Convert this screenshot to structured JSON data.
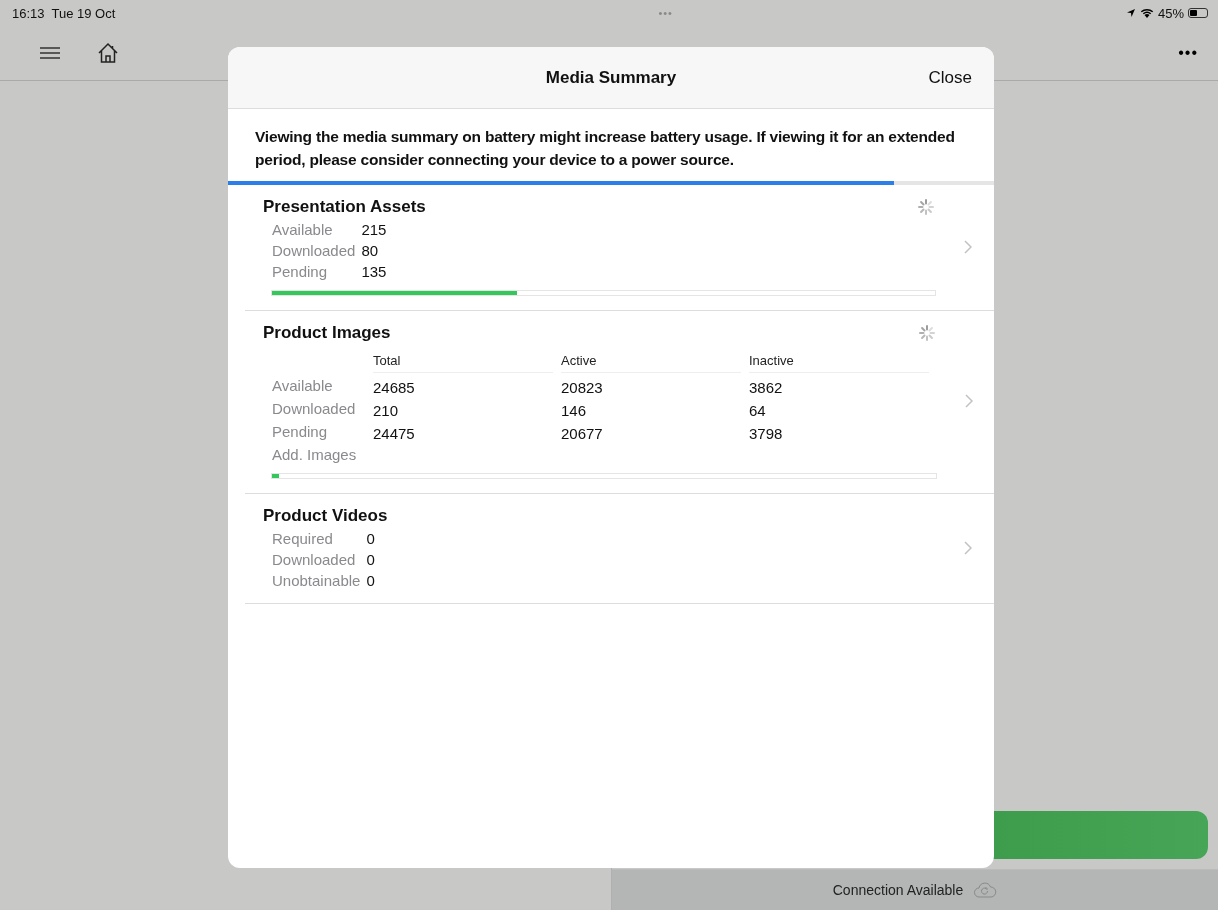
{
  "status_bar": {
    "time": "16:13",
    "date": "Tue 19 Oct",
    "battery": {
      "text": "45%",
      "level": 0.45
    }
  },
  "top_dots": "•••",
  "nav": {
    "more": "•••"
  },
  "background": {
    "connection": "Connection Available"
  },
  "modal": {
    "title": "Media Summary",
    "close": "Close",
    "warning": "Viewing the media summary on battery might increase battery usage. If viewing it for an extended period, please consider connecting your device to a power source.",
    "level": 0.87,
    "sections": [
      {
        "kind": "simple",
        "title": "Presentation Assets",
        "loading": true,
        "level": 0.37,
        "rows": [
          {
            "label": "Available",
            "value": "215"
          },
          {
            "label": "Downloaded",
            "value": "80"
          },
          {
            "label": "Pending",
            "value": "135"
          }
        ]
      },
      {
        "kind": "table",
        "title": "Product Images",
        "loading": true,
        "level": 0.01,
        "columns": [
          "Total",
          "Active",
          "Inactive"
        ],
        "rows": [
          {
            "label": "Available",
            "values": [
              "24685",
              "20823",
              "3862"
            ]
          },
          {
            "label": "Downloaded",
            "values": [
              "210",
              "146",
              "64"
            ]
          },
          {
            "label": "Pending",
            "values": [
              "24475",
              "20677",
              "3798"
            ]
          },
          {
            "label": "Add. Images",
            "values": []
          }
        ]
      },
      {
        "kind": "simple",
        "title": "Product Videos",
        "loading": false,
        "rows": [
          {
            "label": "Required",
            "value": "0"
          },
          {
            "label": "Downloaded",
            "value": "0"
          },
          {
            "label": "Unobtainable",
            "value": "0"
          }
        ]
      }
    ]
  }
}
